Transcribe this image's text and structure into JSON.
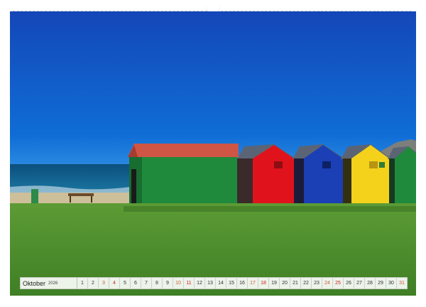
{
  "calendar": {
    "month": "Oktober",
    "year": "2026",
    "days": [
      {
        "n": "1"
      },
      {
        "n": "2"
      },
      {
        "n": "3",
        "type": "weekend"
      },
      {
        "n": "4",
        "type": "sunday"
      },
      {
        "n": "5"
      },
      {
        "n": "6"
      },
      {
        "n": "7"
      },
      {
        "n": "8"
      },
      {
        "n": "9"
      },
      {
        "n": "10",
        "type": "weekend"
      },
      {
        "n": "11",
        "type": "sunday"
      },
      {
        "n": "12"
      },
      {
        "n": "13"
      },
      {
        "n": "14"
      },
      {
        "n": "15"
      },
      {
        "n": "16"
      },
      {
        "n": "17",
        "type": "weekend"
      },
      {
        "n": "18",
        "type": "sunday"
      },
      {
        "n": "19"
      },
      {
        "n": "20"
      },
      {
        "n": "21"
      },
      {
        "n": "22"
      },
      {
        "n": "23"
      },
      {
        "n": "24",
        "type": "weekend"
      },
      {
        "n": "25",
        "type": "sunday"
      },
      {
        "n": "26"
      },
      {
        "n": "27"
      },
      {
        "n": "28"
      },
      {
        "n": "29"
      },
      {
        "n": "30"
      },
      {
        "n": "31",
        "type": "weekend"
      }
    ]
  },
  "colors": {
    "sky": "#0f57c6",
    "grass": "#4a8e2c",
    "hut_green": "#1f8a3c",
    "hut_red": "#e0131d",
    "hut_blue": "#1b3fb5",
    "hut_yellow": "#f4d21c",
    "roof_red": "#d6463a",
    "roof_grey": "#5a6475"
  }
}
